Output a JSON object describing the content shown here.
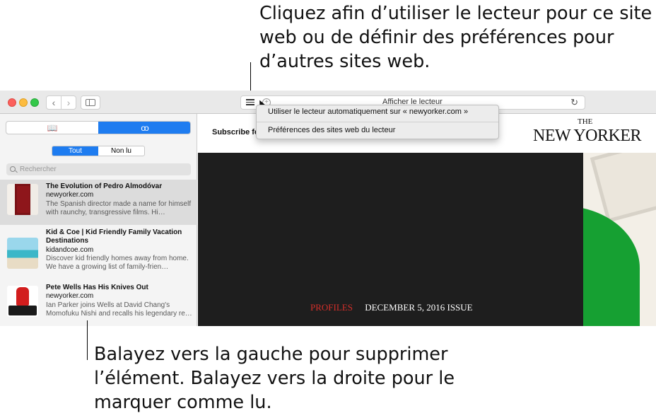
{
  "callouts": {
    "top": "Cliquez afin d’utiliser le lecteur pour ce site web ou de définir des préférences pour d’autres sites web.",
    "bottom": "Balayez vers la gauche pour supprimer l’élément. Balayez vers la droite pour le marquer comme lu."
  },
  "toolbar": {
    "back_glyph": "‹",
    "forward_glyph": "›",
    "address_text": "Afficher le lecteur",
    "reload_glyph": "↻",
    "plus_glyph": "+"
  },
  "sidebar": {
    "tabs": [
      {
        "icon": "book-icon",
        "glyph": "📖",
        "active": false
      },
      {
        "icon": "glasses-icon",
        "glyph": "oo",
        "active": true
      }
    ],
    "filters": [
      {
        "label": "Tout",
        "active": true
      },
      {
        "label": "Non lu",
        "active": false
      }
    ],
    "search_placeholder": "Rechercher",
    "items": [
      {
        "title": "The Evolution of Pedro Almodóvar",
        "domain": "newyorker.com",
        "excerpt": "The Spanish director made a name for himself with raunchy, transgressive films. Hi…"
      },
      {
        "title": "Kid & Coe | Kid Friendly Family Vacation Destinations",
        "domain": "kidandcoe.com",
        "excerpt": "Discover kid friendly homes away from home. We have a growing list of family-frien…"
      },
      {
        "title": "Pete Wells Has His Knives Out",
        "domain": "newyorker.com",
        "excerpt": "Ian Parker joins Wells at David Chang's Momofuku Nishi and recalls his legendary re…"
      }
    ]
  },
  "content": {
    "subscribe": "Subscribe fo",
    "masthead_the": "THE",
    "masthead": "NEW YORKER",
    "hero_section": "PROFILES",
    "hero_issue": "DECEMBER 5, 2016 ISSUE"
  },
  "popover": {
    "items": [
      "Utiliser le lecteur automatiquement sur « newyorker.com »",
      "Préférences des sites web du lecteur"
    ]
  },
  "colors": {
    "accent": "#1e7cf0",
    "section_red": "#d42f2a",
    "hero_bg": "#1e1e1e"
  }
}
